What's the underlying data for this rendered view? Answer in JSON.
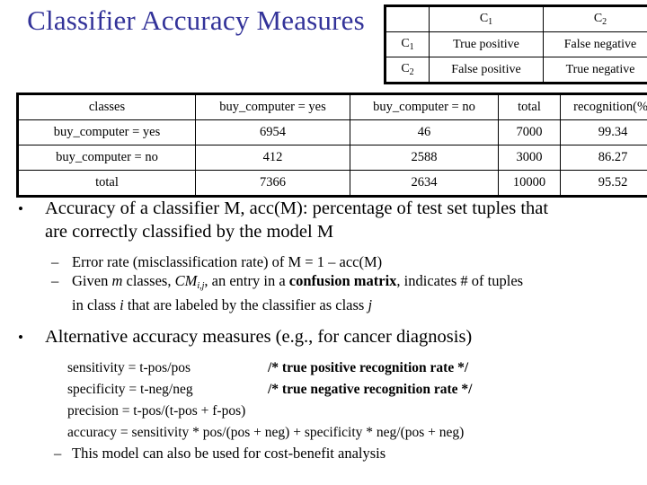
{
  "slide": {
    "title": "Classifier Accuracy Measures",
    "title_color": "#333399"
  },
  "confusion_matrix": {
    "corner_label": "",
    "col_headers": [
      "C₁",
      "C₂"
    ],
    "rows": [
      {
        "label": "C₁",
        "cells": [
          "True positive",
          "False negative"
        ]
      },
      {
        "label": "C₂",
        "cells": [
          "False positive",
          "True negative"
        ]
      }
    ]
  },
  "data_table": {
    "headers": [
      "classes",
      "buy_computer = yes",
      "buy_computer = no",
      "total",
      "recognition(%)"
    ],
    "rows": [
      [
        "buy_computer = yes",
        "6954",
        "46",
        "7000",
        "99.34"
      ],
      [
        "buy_computer = no",
        "412",
        "2588",
        "3000",
        "86.27"
      ],
      [
        "total",
        "7366",
        "2634",
        "10000",
        "95.52"
      ]
    ]
  },
  "content": {
    "bullet_marker": "•",
    "dash_marker": "–",
    "bullet1_line1": "Accuracy of a classifier M, acc(M): percentage of test set tuples that",
    "bullet1_line2": "are correctly classified by the model M",
    "sub1": "Error rate (misclassification rate) of M = 1 – acc(M)",
    "sub2_a": "Given ",
    "sub2_m": "m",
    "sub2_b": " classes, ",
    "sub2_cm": "CM",
    "sub2_cm_sub": "i,j",
    "sub2_c": ", an entry in a ",
    "sub2_bold": "confusion matrix",
    "sub2_d": ", indicates # of tuples",
    "sub2_line2_a": "in class ",
    "sub2_i": "i",
    "sub2_line2_b": "  that are labeled by the classifier as class ",
    "sub2_j": "j",
    "bullet2": "Alternative accuracy measures (e.g., for cancer diagnosis)",
    "formulas": [
      {
        "expr": "sensitivity = t-pos/pos",
        "comment": "/* true positive recognition rate */"
      },
      {
        "expr": "specificity = t-neg/neg",
        "comment": "/* true negative recognition rate */"
      },
      {
        "expr": "precision =  t-pos/(t-pos + f-pos)",
        "comment": ""
      },
      {
        "expr": "accuracy = sensitivity * pos/(pos + neg) + specificity * neg/(pos + neg)",
        "comment": ""
      }
    ],
    "sub3": "This model can also be used for cost-benefit analysis"
  }
}
